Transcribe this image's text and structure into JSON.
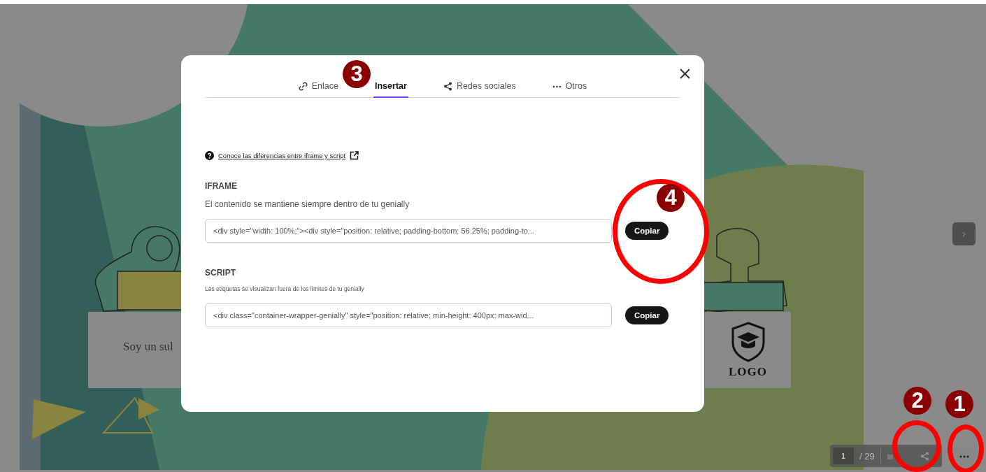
{
  "slide": {
    "subtitle": "Soy un sul",
    "logo": "LOGO",
    "next_button": "›"
  },
  "player_controls": {
    "page_input": "1",
    "page_total": "/ 29"
  },
  "dialog": {
    "tabs": [
      {
        "label": "Enlace",
        "selected": false
      },
      {
        "label": "Insertar",
        "selected": true
      },
      {
        "label": "Redes sociales",
        "selected": false
      },
      {
        "label": "Otros",
        "selected": false
      }
    ],
    "help_link": "Conoce las diferencias entre iframe y script",
    "sections": [
      {
        "heading": "IFRAME",
        "description": "El contenido se mantiene siempre dentro de tu genially",
        "kind": "iframe",
        "code": "<div style=\"width: 100%;\"><div style=\"position: relative; padding-bottom: 56.25%; padding-to...",
        "button": "Copiar"
      },
      {
        "heading": "SCRIPT",
        "description": "Las etiquetas se visualizan fuera de los límites de tu genially",
        "kind": "script",
        "code": "<div class=\"container-wrapper-genially\" style=\"position: relative; min-height: 400px; max-wid...",
        "button": "Copiar"
      }
    ]
  },
  "annotations": [
    {
      "number": "3",
      "circled": false
    },
    {
      "number": "4",
      "circled": true
    },
    {
      "number": "2",
      "circled": true
    },
    {
      "number": "1",
      "circled": true
    }
  ]
}
